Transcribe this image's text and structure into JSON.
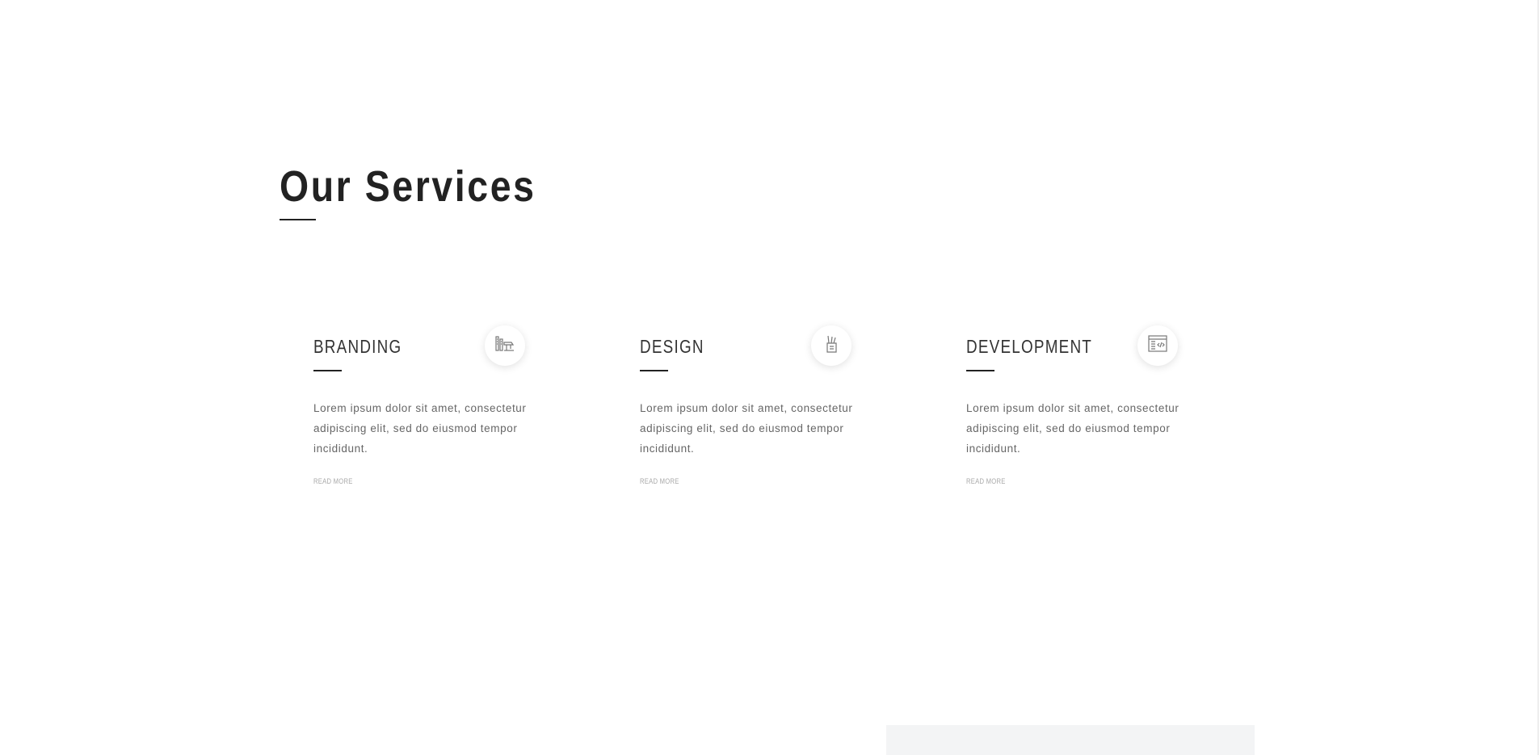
{
  "services": {
    "title": "Our Services",
    "items": [
      {
        "title": "BRANDING",
        "icon": "branding-tools-icon",
        "text": "Lorem ipsum dolor sit amet, consectetur adipiscing elit, sed do eiusmod tempor incididunt.",
        "link": "READ MORE"
      },
      {
        "title": "DESIGN",
        "icon": "design-pencil-cup-icon",
        "text": "Lorem ipsum dolor sit amet, consectetur adipiscing elit, sed do eiusmod tempor incididunt.",
        "link": "READ MORE"
      },
      {
        "title": "DEVELOPMENT",
        "icon": "code-window-icon",
        "text": "Lorem ipsum dolor sit amet, consectetur adipiscing elit, sed do eiusmod tempor incididunt.",
        "link": "READ MORE"
      }
    ]
  },
  "colors": {
    "heading": "#222222",
    "body_text": "#666666",
    "muted_link": "#a9a9a9",
    "panel": "#f3f4f5"
  }
}
